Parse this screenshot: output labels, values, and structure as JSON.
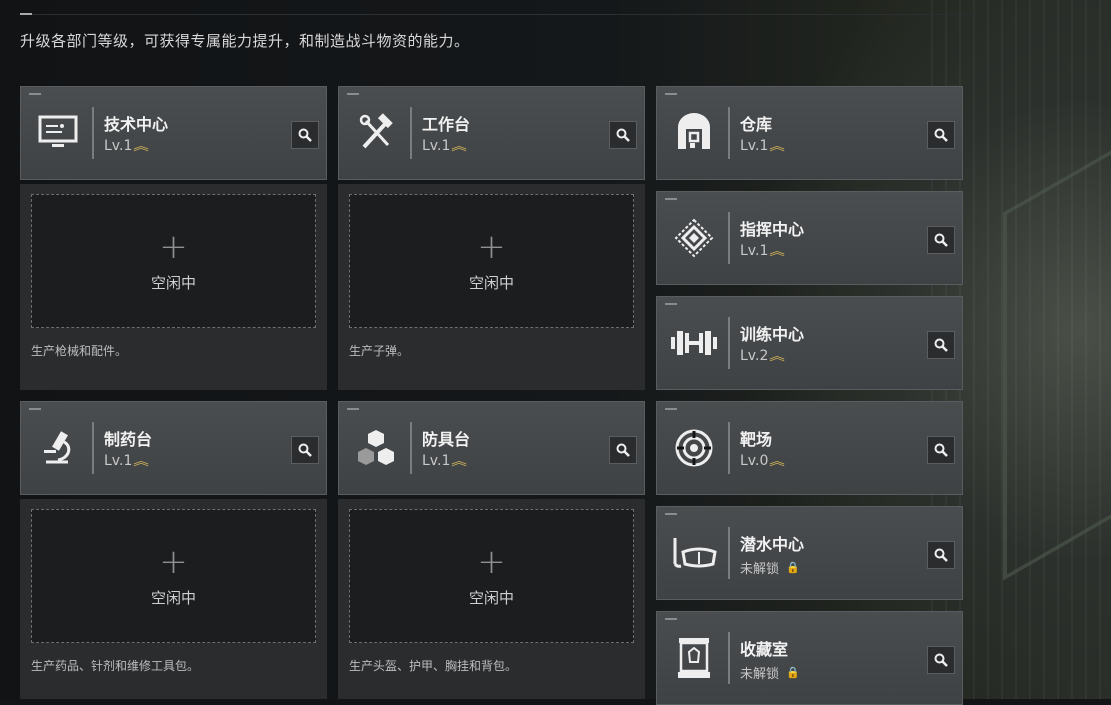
{
  "description": "升级各部门等级，可获得专属能力提升，和制造战斗物资的能力。",
  "accent_color": "#d7b85a",
  "large_cards": [
    {
      "title": "技术中心",
      "level": "Lv.1",
      "icon": "monitor-icon",
      "slot_label": "空闲中",
      "caption": "生产枪械和配件。"
    },
    {
      "title": "工作台",
      "level": "Lv.1",
      "icon": "hammer-wrench-icon",
      "slot_label": "空闲中",
      "caption": "生产子弹。"
    },
    {
      "title": "制药台",
      "level": "Lv.1",
      "icon": "microscope-icon",
      "slot_label": "空闲中",
      "caption": "生产药品、针剂和维修工具包。"
    },
    {
      "title": "防具台",
      "level": "Lv.1",
      "icon": "cubes-icon",
      "slot_label": "空闲中",
      "caption": "生产头盔、护甲、胸挂和背包。"
    }
  ],
  "side_cards": [
    {
      "title": "仓库",
      "level": "Lv.1",
      "icon": "warehouse-icon",
      "locked": false
    },
    {
      "title": "指挥中心",
      "level": "Lv.1",
      "icon": "command-diamond-icon",
      "locked": false
    },
    {
      "title": "训练中心",
      "level": "Lv.2",
      "icon": "dumbbell-icon",
      "locked": false
    },
    {
      "title": "靶场",
      "level": "Lv.0",
      "icon": "target-icon",
      "locked": false
    },
    {
      "title": "潜水中心",
      "level": "未解锁",
      "icon": "diving-mask-icon",
      "locked": true
    },
    {
      "title": "收藏室",
      "level": "未解锁",
      "icon": "display-case-icon",
      "locked": true
    }
  ]
}
